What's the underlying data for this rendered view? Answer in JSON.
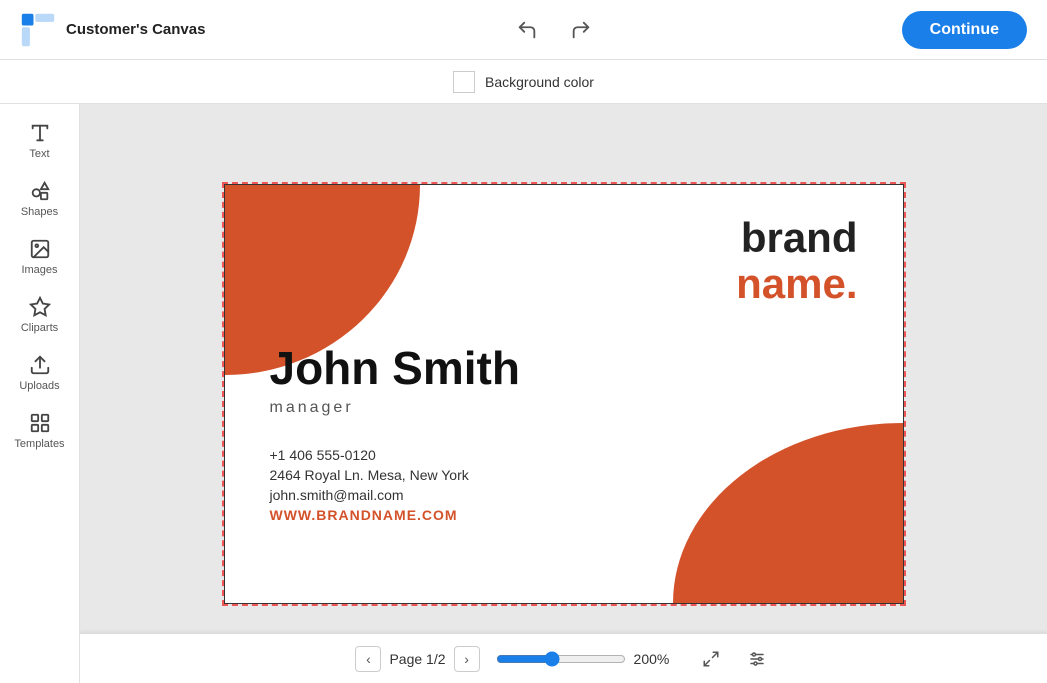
{
  "app": {
    "name": "Customer's Canvas",
    "continue_label": "Continue"
  },
  "toolbar": {
    "bg_color_label": "Background color",
    "undo_icon": "↩",
    "redo_icon": "↪"
  },
  "sidebar": {
    "items": [
      {
        "id": "text",
        "label": "Text",
        "icon": "T"
      },
      {
        "id": "shapes",
        "label": "Shapes",
        "icon": "shapes"
      },
      {
        "id": "images",
        "label": "Images",
        "icon": "images"
      },
      {
        "id": "cliparts",
        "label": "Cliparts",
        "icon": "star"
      },
      {
        "id": "uploads",
        "label": "Uploads",
        "icon": "upload"
      },
      {
        "id": "templates",
        "label": "Templates",
        "icon": "templates"
      }
    ]
  },
  "card": {
    "brand_top": "brand",
    "brand_bottom": "name.",
    "person_name": "John Smith",
    "person_title": "manager",
    "phone": "+1 406 555-0120",
    "address": "2464 Royal Ln. Mesa, New York",
    "email": "john.smith@mail.com",
    "website": "WWW.BRANDNAME.COM",
    "accent_color": "#d4522a"
  },
  "bottom_bar": {
    "page_label": "Page 1/2",
    "zoom_value": "200",
    "zoom_label": "200%",
    "prev_icon": "‹",
    "next_icon": "›"
  }
}
